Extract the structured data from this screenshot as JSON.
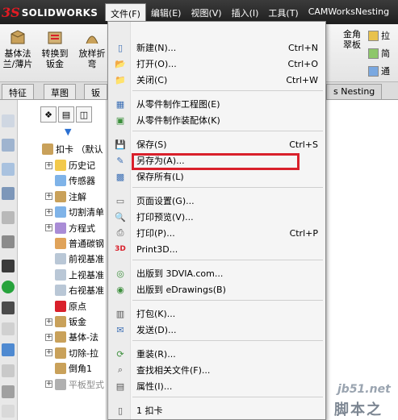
{
  "app": {
    "name": "SOLIDWORKS",
    "logo_mark": "3S"
  },
  "menubar": {
    "items": [
      {
        "label": "文件(F)",
        "active": true
      },
      {
        "label": "编辑(E)"
      },
      {
        "label": "视图(V)"
      },
      {
        "label": "插入(I)"
      },
      {
        "label": "工具(T)"
      },
      {
        "label": "CAMWorksNesting"
      }
    ]
  },
  "toolbar": {
    "buttons": [
      {
        "label_line1": "基体法",
        "label_line2": "兰/薄片"
      },
      {
        "label_line1": "转换到",
        "label_line2": "钣金"
      },
      {
        "label_line1": "放样折",
        "label_line2": "弯"
      }
    ],
    "right_button": {
      "label_line1": "金角",
      "label_line2": "翠板"
    },
    "side_items": [
      {
        "label": "拉"
      },
      {
        "label": "简"
      },
      {
        "label": "通"
      }
    ]
  },
  "tabs": [
    {
      "label": "特征"
    },
    {
      "label": "草图"
    },
    {
      "label": "钣"
    },
    {
      "label": "s Nesting"
    }
  ],
  "tree": {
    "root_label": "扣卡 （默认",
    "items": [
      {
        "label": "历史记",
        "expandable": true
      },
      {
        "label": "传感器",
        "expandable": false
      },
      {
        "label": "注解",
        "expandable": true
      },
      {
        "label": "切割清单",
        "expandable": true
      },
      {
        "label": "方程式",
        "expandable": true
      },
      {
        "label": "普通碳钢",
        "expandable": false
      },
      {
        "label": "前视基准",
        "expandable": false
      },
      {
        "label": "上视基准",
        "expandable": false
      },
      {
        "label": "右视基准",
        "expandable": false
      },
      {
        "label": "原点",
        "expandable": false
      },
      {
        "label": "钣金",
        "expandable": true
      },
      {
        "label": "基体-法",
        "expandable": true
      },
      {
        "label": "切除-拉",
        "expandable": true
      },
      {
        "label": "倒角1",
        "expandable": false
      },
      {
        "label": "平板型式",
        "expandable": true,
        "muted": true
      }
    ]
  },
  "file_menu": {
    "items": [
      {
        "label": "新建(N)...",
        "shortcut": "Ctrl+N",
        "icon": "new-document-icon"
      },
      {
        "label": "打开(O)...",
        "shortcut": "Ctrl+O",
        "icon": "open-folder-icon"
      },
      {
        "label": "关闭(C)",
        "shortcut": "Ctrl+W",
        "icon": "close-folder-icon"
      },
      {
        "label": "从零件制作工程图(E)",
        "shortcut": "",
        "icon": "make-drawing-icon"
      },
      {
        "label": "从零件制作装配体(K)",
        "shortcut": "",
        "icon": "make-assembly-icon"
      },
      {
        "label": "保存(S)",
        "shortcut": "Ctrl+S",
        "icon": "save-icon"
      },
      {
        "label": "另存为(A)...",
        "shortcut": "",
        "icon": "save-as-icon",
        "highlighted": true
      },
      {
        "label": "保存所有(L)",
        "shortcut": "",
        "icon": "save-all-icon"
      },
      {
        "label": "页面设置(G)...",
        "shortcut": "",
        "icon": "page-setup-icon"
      },
      {
        "label": "打印预览(V)...",
        "shortcut": "",
        "icon": "print-preview-icon"
      },
      {
        "label": "打印(P)...",
        "shortcut": "Ctrl+P",
        "icon": "print-icon"
      },
      {
        "label": "Print3D...",
        "shortcut": "",
        "icon": "print3d-icon"
      },
      {
        "label": "出版到 3DVIA.com...",
        "shortcut": "",
        "icon": "publish-3dvia-icon"
      },
      {
        "label": "出版到 eDrawings(B)",
        "shortcut": "",
        "icon": "publish-edrawings-icon"
      },
      {
        "label": "打包(K)...",
        "shortcut": "",
        "icon": "pack-and-go-icon"
      },
      {
        "label": "发送(D)...",
        "shortcut": "",
        "icon": "send-icon"
      },
      {
        "label": "重装(R)...",
        "shortcut": "",
        "icon": "reload-icon"
      },
      {
        "label": "查找相关文件(F)...",
        "shortcut": "",
        "icon": "find-references-icon"
      },
      {
        "label": "属性(I)...",
        "shortcut": "",
        "icon": "properties-icon"
      },
      {
        "label": "1 扣卡",
        "shortcut": "",
        "icon": "recent-file-icon"
      }
    ]
  },
  "watermark": {
    "url": "jb51.net",
    "name": "脚本之家"
  },
  "colors": {
    "highlight_border": "#d9202b",
    "titlebar": "#2a2a2a",
    "logo_red": "#e31b23"
  }
}
